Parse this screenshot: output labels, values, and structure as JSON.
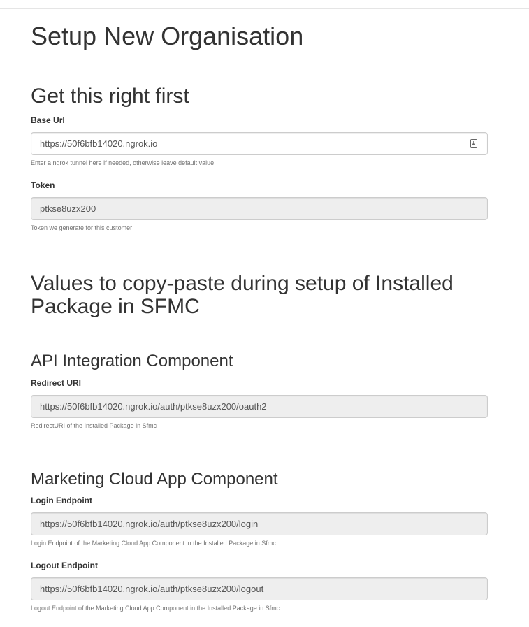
{
  "page": {
    "title": "Setup New Organisation"
  },
  "first_section": {
    "heading": "Get this right first",
    "base_url": {
      "label": "Base Url",
      "value": "https://50f6bfb14020.ngrok.io",
      "help": "Enter a ngrok tunnel here if needed, otherwise leave default value",
      "icon": "contact-card-icon"
    },
    "token": {
      "label": "Token",
      "value": "ptkse8uzx200",
      "help": "Token we generate for this customer"
    }
  },
  "copy_section": {
    "heading_line1": "Values to copy-paste during setup of Installed",
    "heading_line2": "Package in SFMC"
  },
  "api_component": {
    "heading": "API Integration Component",
    "redirect_uri": {
      "label": "Redirect URI",
      "value": "https://50f6bfb14020.ngrok.io/auth/ptkse8uzx200/oauth2",
      "help": "RedirectURI of the Installed Package in Sfmc"
    }
  },
  "app_component": {
    "heading": "Marketing Cloud App Component",
    "login_endpoint": {
      "label": "Login Endpoint",
      "value": "https://50f6bfb14020.ngrok.io/auth/ptkse8uzx200/login",
      "help": "Login Endpoint of the Marketing Cloud App Component in the Installed Package in Sfmc"
    },
    "logout_endpoint": {
      "label": "Logout Endpoint",
      "value": "https://50f6bfb14020.ngrok.io/auth/ptkse8uzx200/logout",
      "help": "Logout Endpoint of the Marketing Cloud App Component in the Installed Package in Sfmc"
    }
  }
}
